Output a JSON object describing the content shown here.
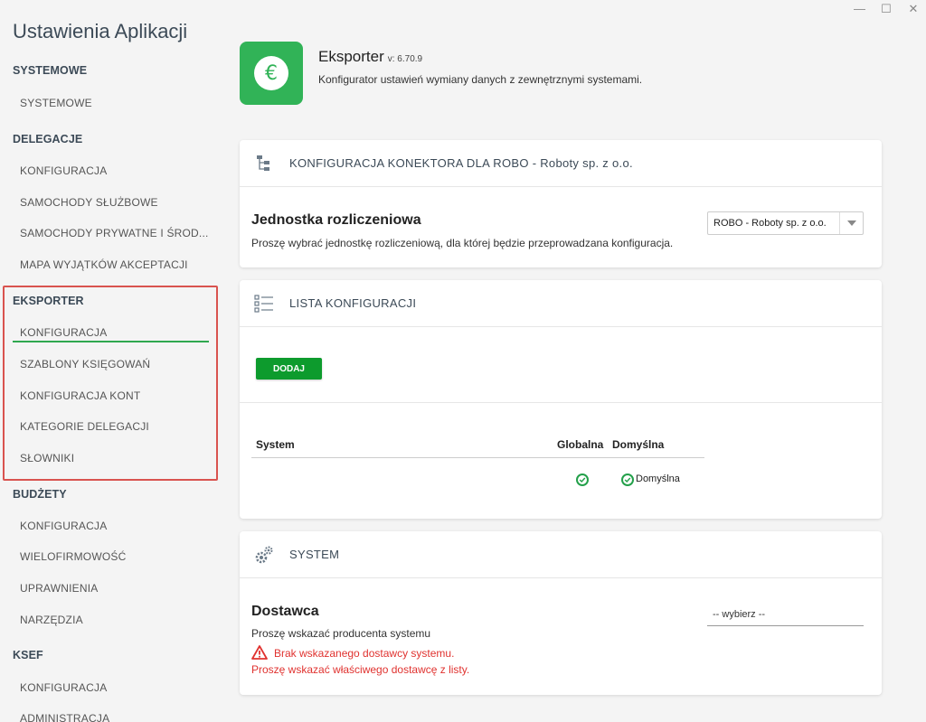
{
  "window": {
    "minimize": "—",
    "maximize": "☐",
    "close": "✕"
  },
  "sidebar": {
    "title": "Ustawienia Aplikacji",
    "sections": [
      {
        "label": "SYSTEMOWE",
        "items": [
          "SYSTEMOWE"
        ]
      },
      {
        "label": "DELEGACJE",
        "items": [
          "KONFIGURACJA",
          "SAMOCHODY SŁUŻBOWE",
          "SAMOCHODY PRYWATNE I ŚROD...",
          "MAPA WYJĄTKÓW AKCEPTACJI"
        ]
      },
      {
        "label": "EKSPORTER",
        "items": [
          "KONFIGURACJA",
          "SZABLONY KSIĘGOWAŃ",
          "KONFIGURACJA KONT",
          "KATEGORIE DELEGACJI",
          "SŁOWNIKI"
        ]
      },
      {
        "label": "BUDŻETY",
        "items": [
          "KONFIGURACJA",
          "WIELOFIRMOWOŚĆ",
          "UPRAWNIENIA",
          "NARZĘDZIA"
        ]
      },
      {
        "label": "KSEF",
        "items": [
          "KONFIGURACJA",
          "ADMINISTRACJA"
        ]
      }
    ],
    "active_item": "EKSPORTER / KONFIGURACJA",
    "highlight_color": "#d9534f",
    "active_color": "#2fa84f"
  },
  "header": {
    "icon": "euro-icon",
    "icon_glyph": "€",
    "name": "Eksporter",
    "version": "v: 6.70.9",
    "description": "Konfigurator ustawień wymiany danych z zewnętrznymi systemami.",
    "brand_color": "#31b357"
  },
  "connector_card": {
    "icon": "tree-icon",
    "title": "KONFIGURACJA KONEKTORA DLA ROBO - Roboty sp. z o.o.",
    "unit_title": "Jednostka rozliczeniowa",
    "unit_desc": "Proszę wybrać jednostkę rozliczeniową, dla której będzie przeprowadzana konfiguracja.",
    "unit_value": "ROBO - Roboty sp. z o.o."
  },
  "list_card": {
    "icon": "list-icon",
    "title": "LISTA KONFIGURACJI",
    "add_button": "DODAJ",
    "columns": [
      "System",
      "Globalna",
      "Domyślna"
    ],
    "rows": [
      {
        "system": "",
        "global": true,
        "default": true,
        "default_label": "Domyślna"
      }
    ]
  },
  "system_card": {
    "icon": "gears-icon",
    "title": "SYSTEM",
    "provider_title": "Dostawca",
    "provider_desc": "Proszę wskazać producenta systemu",
    "provider_placeholder": "-- wybierz --",
    "error_line1": "Brak wskazanego dostawcy systemu.",
    "error_line2": "Proszę wskazać właściwego dostawcę z listy.",
    "error_color": "#e0322f"
  }
}
